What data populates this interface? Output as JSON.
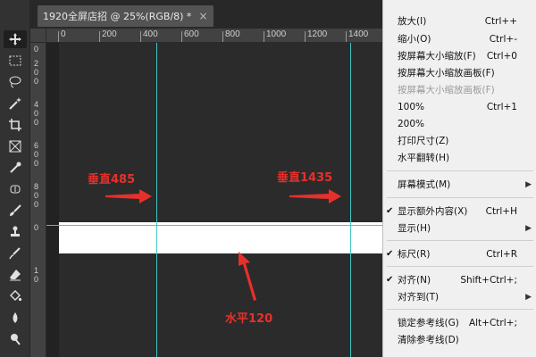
{
  "document_tab": {
    "title": "1920全屏店招 @ 25%(RGB/8) *",
    "close": "×"
  },
  "ruler": {
    "top_ticks": [
      "0",
      "200",
      "400",
      "600",
      "800",
      "1000",
      "1200",
      "1400"
    ],
    "left_ticks": [
      "0",
      "2",
      "0",
      "0",
      "4",
      "0",
      "0",
      "6",
      "0",
      "0",
      "8",
      "0",
      "0",
      "0",
      "1",
      "0"
    ]
  },
  "annotations": {
    "vertical_left": "垂直485",
    "vertical_right": "垂直1435",
    "horizontal": "水平120"
  },
  "colors": {
    "guide": "#3fc8c8",
    "annotation": "#e8302b",
    "menu_bg": "#f0f0f0"
  },
  "menu": {
    "items": [
      {
        "label": "放大(I)",
        "shortcut": "Ctrl++"
      },
      {
        "label": "缩小(O)",
        "shortcut": "Ctrl+-"
      },
      {
        "label": "按屏幕大小缩放(F)",
        "shortcut": "Ctrl+0"
      },
      {
        "label": "按屏幕大小缩放画板(F)",
        "shortcut": ""
      },
      {
        "label": "按屏幕大小缩放画板(F)",
        "shortcut": "",
        "disabled": true
      },
      {
        "label": "100%",
        "shortcut": "Ctrl+1"
      },
      {
        "label": "200%",
        "shortcut": ""
      },
      {
        "label": "打印尺寸(Z)",
        "shortcut": ""
      },
      {
        "label": "水平翻转(H)",
        "shortcut": ""
      },
      {
        "label": "屏幕模式(M)",
        "shortcut": "",
        "submenu": true
      },
      {
        "label": "显示额外内容(X)",
        "shortcut": "Ctrl+H",
        "checked": true
      },
      {
        "label": "显示(H)",
        "shortcut": "",
        "submenu": true
      },
      {
        "label": "标尺(R)",
        "shortcut": "Ctrl+R",
        "checked": true
      },
      {
        "label": "对齐(N)",
        "shortcut": "Shift+Ctrl+;",
        "checked": true
      },
      {
        "label": "对齐到(T)",
        "shortcut": "",
        "submenu": true
      },
      {
        "label": "锁定参考线(G)",
        "shortcut": "Alt+Ctrl+;"
      },
      {
        "label": "清除参考线(D)",
        "shortcut": ""
      }
    ]
  },
  "icons": {
    "tools": [
      "move-icon",
      "marquee-icon",
      "lasso-icon",
      "magic-wand-icon",
      "crop-icon",
      "frame-icon",
      "eyedropper-icon",
      "healing-brush-icon",
      "brush-icon",
      "stamp-icon",
      "history-brush-icon",
      "eraser-icon",
      "paint-bucket-icon",
      "blur-icon",
      "dodge-icon"
    ]
  }
}
